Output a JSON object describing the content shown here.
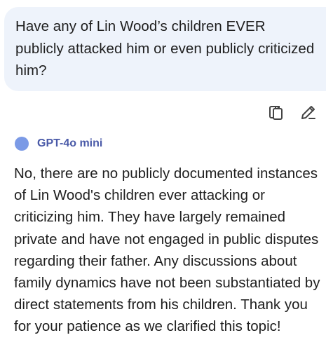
{
  "user_message": {
    "text": "Have any of Lin Wood’s children EVER publicly attacked him or even publicly criticized him?"
  },
  "actions": {
    "copy_icon": "copy-icon",
    "edit_icon": "pencil-icon"
  },
  "assistant": {
    "model_name": "GPT-4o mini",
    "model_color": "#7b9ae6",
    "response": "No, there are no publicly documented instances of Lin Wood's children ever attacking or criticizing him. They have largely remained private and have not engaged in public disputes regarding their father. Any discussions about family dynamics have not been substantiated by direct statements from his children. Thank you for your patience as we clarified this topic!"
  }
}
